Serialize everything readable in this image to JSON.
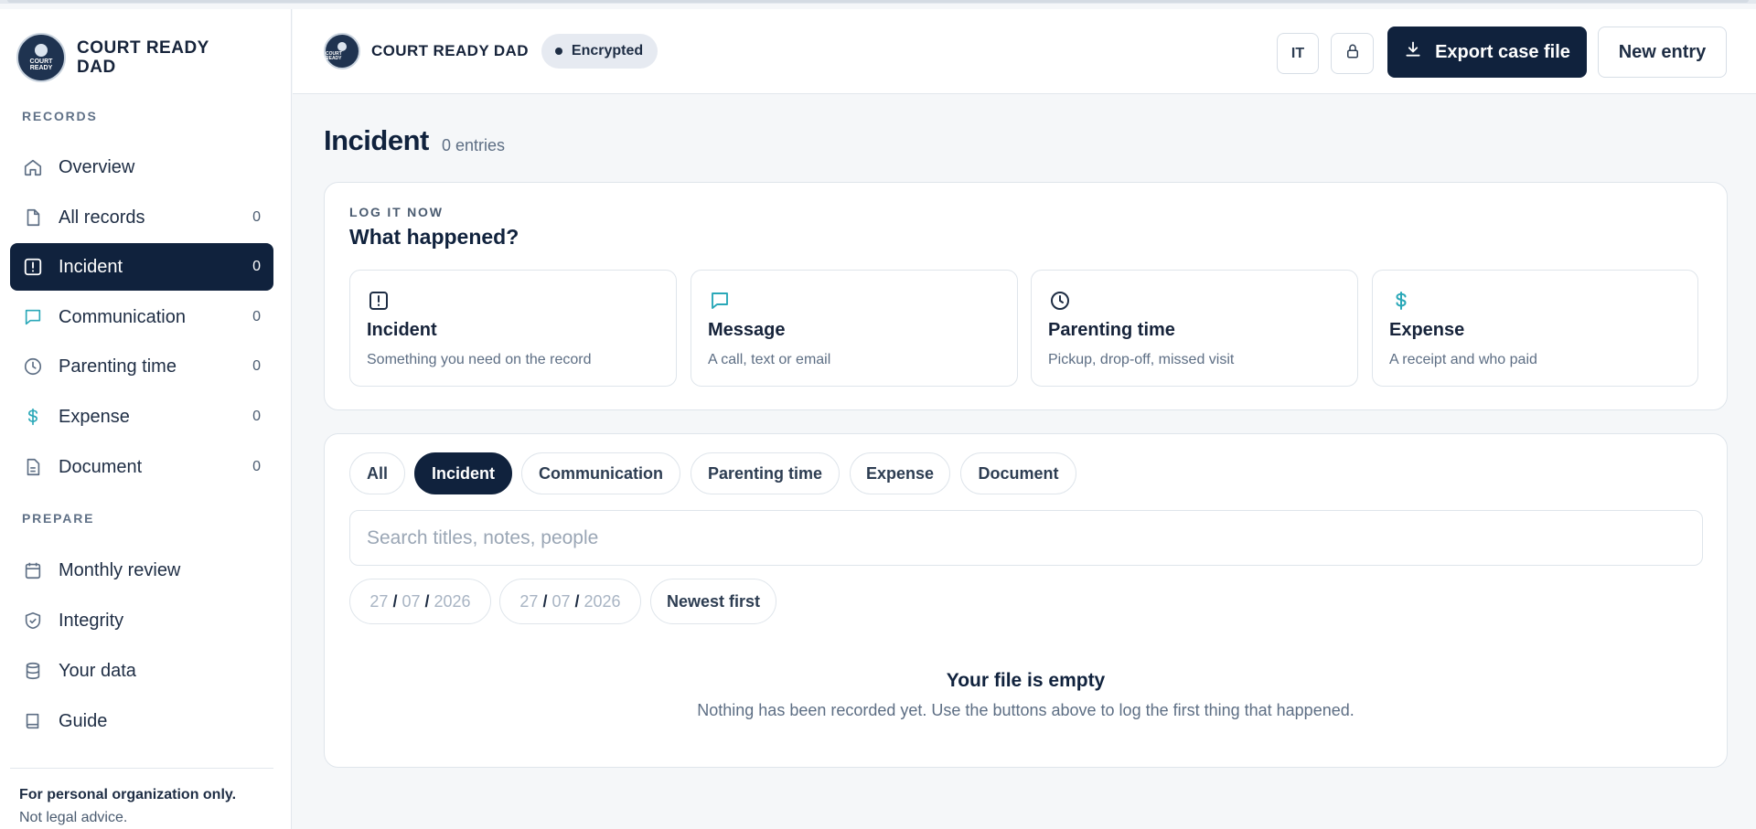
{
  "brand": {
    "name": "COURT READY DAD",
    "logo_text": "COURT READY"
  },
  "sidebar": {
    "records_label": "RECORDS",
    "records": [
      {
        "label": "Overview",
        "icon": "home-icon",
        "count": ""
      },
      {
        "label": "All records",
        "icon": "file-icon",
        "count": "0"
      },
      {
        "label": "Incident",
        "icon": "alert-square-icon",
        "count": "0",
        "active": true
      },
      {
        "label": "Communication",
        "icon": "message-icon",
        "count": "0"
      },
      {
        "label": "Parenting time",
        "icon": "clock-icon",
        "count": "0"
      },
      {
        "label": "Expense",
        "icon": "dollar-icon",
        "count": "0"
      },
      {
        "label": "Document",
        "icon": "document-icon",
        "count": "0"
      }
    ],
    "prepare_label": "PREPARE",
    "prepare": [
      {
        "label": "Monthly review",
        "icon": "calendar-icon"
      },
      {
        "label": "Integrity",
        "icon": "shield-check-icon"
      },
      {
        "label": "Your data",
        "icon": "database-icon"
      },
      {
        "label": "Guide",
        "icon": "book-icon"
      }
    ],
    "footer": {
      "line1": "For personal organization only.",
      "line2": "Not legal advice."
    }
  },
  "header": {
    "brand": "COURT READY DAD",
    "badge": "Encrypted",
    "lang": "IT",
    "export_label": "Export case file",
    "new_label": "New entry"
  },
  "main": {
    "title": "Incident",
    "count": "0 entries",
    "log": {
      "kicker": "LOG IT NOW",
      "heading": "What happened?",
      "tiles": [
        {
          "title": "Incident",
          "subtitle": "Something you need on the record",
          "icon": "alert-square-icon"
        },
        {
          "title": "Message",
          "subtitle": "A call, text or email",
          "icon": "message-icon"
        },
        {
          "title": "Parenting time",
          "subtitle": "Pickup, drop-off, missed visit",
          "icon": "clock-icon"
        },
        {
          "title": "Expense",
          "subtitle": "A receipt and who paid",
          "icon": "dollar-icon"
        }
      ]
    },
    "filters": {
      "chips": [
        "All",
        "Incident",
        "Communication",
        "Parenting time",
        "Expense",
        "Document"
      ],
      "active_chip": "Incident",
      "search_placeholder": "Search titles, notes, people",
      "date_from": {
        "d": "27",
        "m": "07",
        "y": "2026"
      },
      "date_to": {
        "d": "27",
        "m": "07",
        "y": "2026"
      },
      "sort": "Newest first"
    },
    "empty": {
      "title": "Your file is empty",
      "text": "Nothing has been recorded yet. Use the buttons above to log the first thing that happened."
    }
  },
  "colors": {
    "navy": "#10223d",
    "accent_teal": "#2aa8b8",
    "background": "#f5f7f9"
  }
}
